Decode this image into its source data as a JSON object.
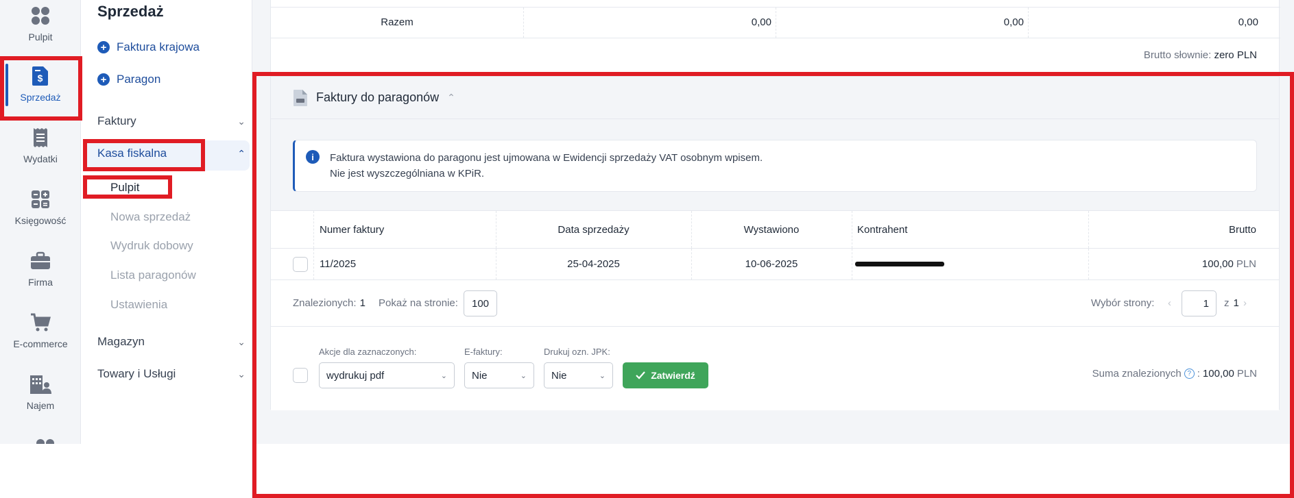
{
  "rail": {
    "items": [
      {
        "label": "Pulpit",
        "icon": "dashboard-icon"
      },
      {
        "label": "Sprzedaż",
        "icon": "invoice-dollar-icon"
      },
      {
        "label": "Wydatki",
        "icon": "receipt-icon"
      },
      {
        "label": "Księgowość",
        "icon": "calculator-icon"
      },
      {
        "label": "Firma",
        "icon": "briefcase-icon"
      },
      {
        "label": "E-commerce",
        "icon": "cart-icon"
      },
      {
        "label": "Najem",
        "icon": "building-person-icon"
      }
    ],
    "active": "Sprzedaż"
  },
  "menu": {
    "title": "Sprzedaż",
    "add_invoice": "Faktura krajowa",
    "add_receipt": "Paragon",
    "sections": {
      "invoices": "Faktury",
      "cash_register": "Kasa fiskalna",
      "warehouse": "Magazyn",
      "goods": "Towary i Usługi"
    },
    "cash_register_items": [
      "Pulpit",
      "Nowa sprzedaż",
      "Wydruk dobowy",
      "Lista paragonów",
      "Ustawienia"
    ],
    "active_item": "Pulpit"
  },
  "totals": {
    "label": "Razem",
    "values": [
      "0,00",
      "0,00",
      "0,00"
    ],
    "brutto_words_label": "Brutto słownie:",
    "brutto_words_value": "zero PLN"
  },
  "panel": {
    "title": "Faktury do paragonów",
    "info_line1": "Faktura wystawiona do paragonu jest ujmowana w Ewidencji sprzedaży VAT osobnym wpisem.",
    "info_line2": "Nie jest wyszczególniana w KPiR.",
    "columns": [
      "Numer faktury",
      "Data sprzedaży",
      "Wystawiono",
      "Kontrahent",
      "Brutto"
    ],
    "rows": [
      {
        "number": "11/2025",
        "sale_date": "25-04-2025",
        "issued": "10-06-2025",
        "contractor": "[redacted]",
        "brutto": "100,00",
        "currency": "PLN"
      }
    ],
    "found_label": "Znalezionych:",
    "found_count": "1",
    "per_page_label": "Pokaż na stronie:",
    "per_page_value": "100",
    "page_label": "Wybór strony:",
    "page_value": "1",
    "page_of": "z",
    "page_total": "1",
    "actions_label": "Akcje dla zaznaczonych:",
    "actions_value": "wydrukuj pdf",
    "einvoice_label": "E-faktury:",
    "einvoice_value": "Nie",
    "jpk_label": "Drukuj ozn. JPK:",
    "jpk_value": "Nie",
    "confirm_label": "Zatwierdź",
    "sum_label": "Suma znalezionych",
    "sum_value": "100,00",
    "sum_currency": "PLN"
  },
  "colors": {
    "accent": "#1e5bb8",
    "confirm": "#3fa55a",
    "highlight": "#e01c24"
  }
}
